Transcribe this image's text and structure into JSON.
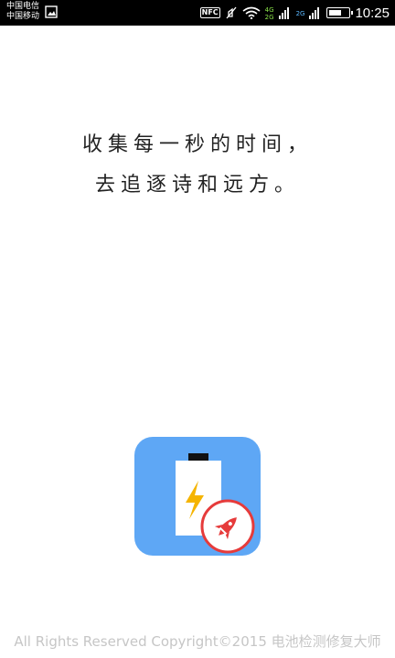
{
  "status_bar": {
    "carrier_1": "中国电信",
    "carrier_2": "中国移动",
    "nfc_label": "NFC",
    "net_tag_4g": "4G",
    "net_tag_2g_a": "2G",
    "net_tag_2g_b": "2G",
    "time": "10:25",
    "battery_level": 0.7,
    "icons": [
      "gallery-icon",
      "nfc-icon",
      "mute-icon",
      "wifi-icon",
      "signal-icon",
      "battery-icon"
    ]
  },
  "splash": {
    "line_1": "收集每一秒的时间，",
    "line_2": "去追逐诗和远方。"
  },
  "logo": {
    "background": "#5ea7f5",
    "icons": [
      "battery-icon",
      "lightning-icon",
      "rocket-icon"
    ],
    "lightning_color": "#f5b400",
    "rocket_color": "#e63b3b",
    "badge_border_color": "#e63b3b"
  },
  "footer": {
    "text": "All Rights Reserved Copyright©2015 电池检测修复大师"
  }
}
